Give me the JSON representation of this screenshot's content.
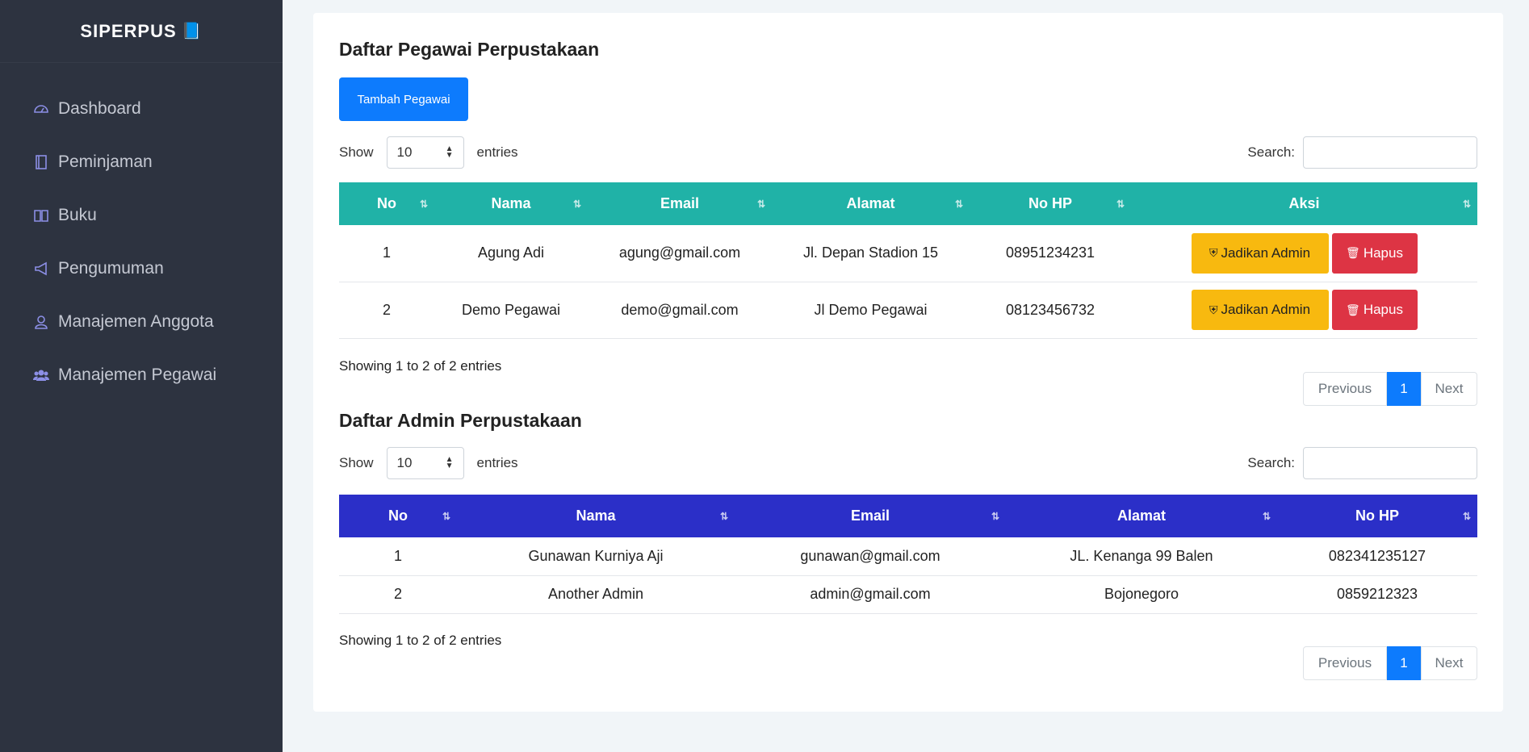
{
  "sidebar": {
    "brand": "SIPERPUS",
    "items": [
      {
        "label": "Dashboard",
        "icon": "dashboard-icon"
      },
      {
        "label": "Peminjaman",
        "icon": "book-icon"
      },
      {
        "label": "Buku",
        "icon": "open-book-icon"
      },
      {
        "label": "Pengumuman",
        "icon": "megaphone-icon"
      },
      {
        "label": "Manajemen Anggota",
        "icon": "user-icon"
      },
      {
        "label": "Manajemen Pegawai",
        "icon": "users-icon"
      }
    ]
  },
  "pegawai": {
    "title": "Daftar Pegawai Perpustakaan",
    "add_button": "Tambah Pegawai",
    "show_label": "Show",
    "length_value": "10",
    "entries_label": "entries",
    "search_label": "Search:",
    "columns": [
      "No",
      "Nama",
      "Email",
      "Alamat",
      "No HP",
      "Aksi"
    ],
    "rows": [
      {
        "no": "1",
        "nama": "Agung Adi",
        "email": "agung@gmail.com",
        "alamat": "Jl. Depan Stadion 15",
        "hp": "08951234231"
      },
      {
        "no": "2",
        "nama": "Demo Pegawai",
        "email": "demo@gmail.com",
        "alamat": "Jl Demo Pegawai",
        "hp": "08123456732"
      }
    ],
    "action_admin": "Jadikan Admin",
    "action_delete": "Hapus",
    "info": "Showing 1 to 2 of 2 entries",
    "pager": {
      "prev": "Previous",
      "current": "1",
      "next": "Next"
    }
  },
  "admin": {
    "title": "Daftar Admin Perpustakaan",
    "show_label": "Show",
    "length_value": "10",
    "entries_label": "entries",
    "search_label": "Search:",
    "columns": [
      "No",
      "Nama",
      "Email",
      "Alamat",
      "No HP"
    ],
    "rows": [
      {
        "no": "1",
        "nama": "Gunawan Kurniya Aji",
        "email": "gunawan@gmail.com",
        "alamat": "JL. Kenanga 99 Balen",
        "hp": "082341235127"
      },
      {
        "no": "2",
        "nama": "Another Admin",
        "email": "admin@gmail.com",
        "alamat": "Bojonegoro",
        "hp": "0859212323"
      }
    ],
    "info": "Showing 1 to 2 of 2 entries",
    "pager": {
      "prev": "Previous",
      "current": "1",
      "next": "Next"
    }
  },
  "colors": {
    "primary": "#0d7bfd",
    "teal": "#20b2a7",
    "indigo": "#2b2fc8",
    "warning": "#f8b90f",
    "danger": "#dd3444",
    "sidebar": "#2d3340"
  }
}
